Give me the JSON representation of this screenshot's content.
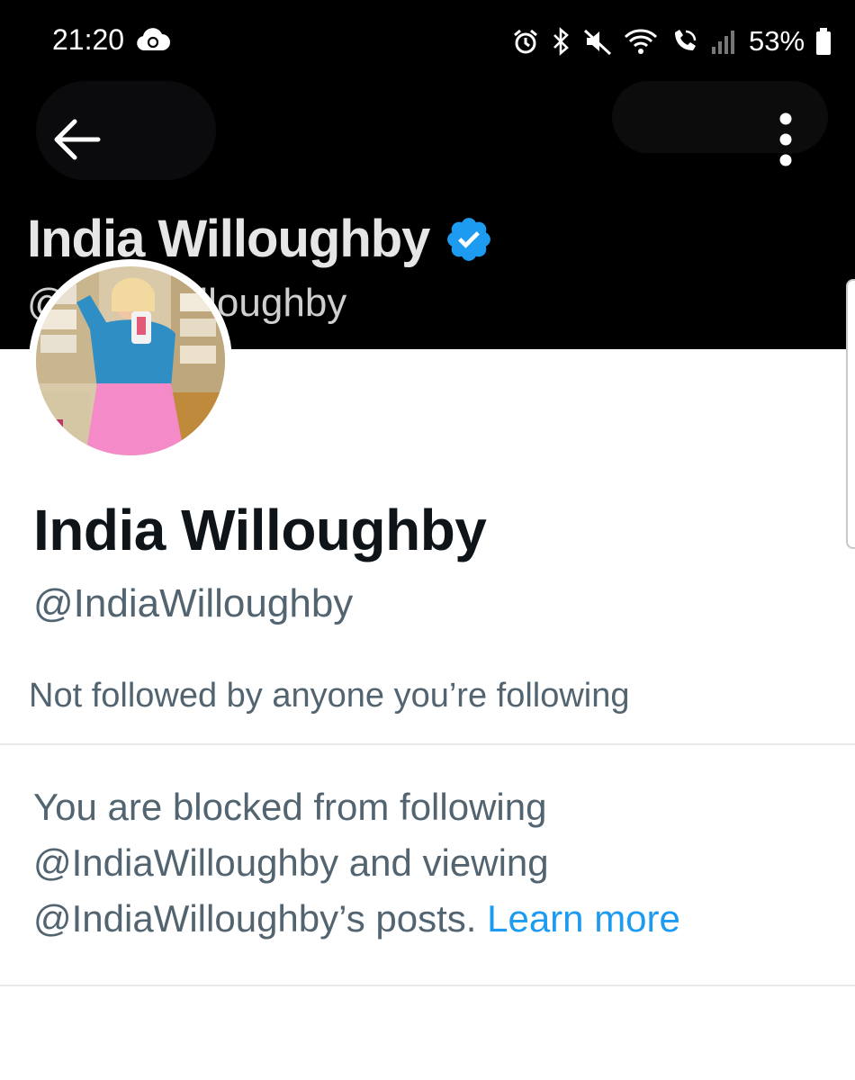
{
  "status_bar": {
    "time": "21:20",
    "battery": "53%",
    "icons": [
      "cloud-sync-icon",
      "alarm-icon",
      "bluetooth-icon",
      "mute-icon",
      "wifi-icon",
      "wifi-call-icon",
      "signal-icon",
      "battery-icon"
    ]
  },
  "header": {
    "banner_name": "India Willoughby",
    "banner_handle": "@IndiaWilloughby",
    "back_icon": "arrow-left-icon",
    "menu_icon": "more-vertical-icon"
  },
  "profile": {
    "name": "India Willoughby",
    "handle": "@IndiaWilloughby",
    "followed_by": "Not followed by anyone you’re following",
    "blocked_line1": "You are blocked from following",
    "blocked_line2": "@IndiaWilloughby and viewing",
    "blocked_line3": "@IndiaWilloughby’s posts.",
    "learn_more": "Learn more"
  },
  "colors": {
    "verified_blue": "#1d9bf0",
    "link_blue": "#1d9bf0",
    "text_primary": "#0f1419",
    "text_secondary": "#536471"
  }
}
